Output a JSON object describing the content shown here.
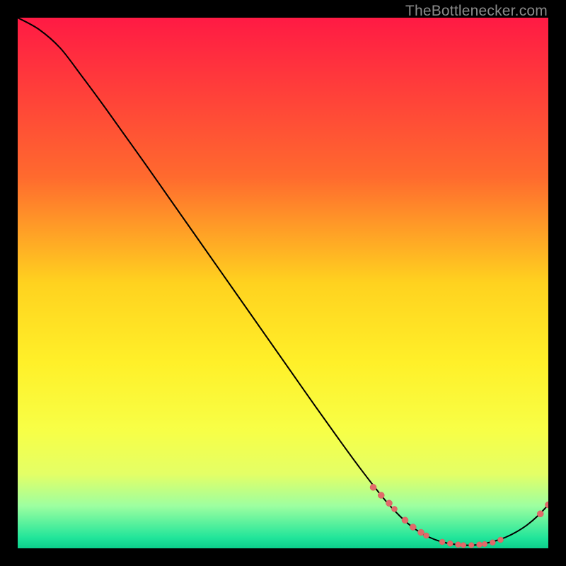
{
  "watermark": "TheBottlenecker.com",
  "colors": {
    "curve_stroke": "#000000",
    "marker_fill": "#e16a6a",
    "marker_stroke": "#d95b5b"
  },
  "chart_data": {
    "type": "line",
    "title": "",
    "xlabel": "",
    "ylabel": "",
    "xlim": [
      0,
      100
    ],
    "ylim": [
      0,
      100
    ],
    "grid": false,
    "legend": false,
    "gradient_stops": [
      {
        "pos": 0.0,
        "color": "#ff1a44"
      },
      {
        "pos": 0.3,
        "color": "#ff6a2e"
      },
      {
        "pos": 0.5,
        "color": "#ffd21f"
      },
      {
        "pos": 0.65,
        "color": "#fff029"
      },
      {
        "pos": 0.78,
        "color": "#f7ff47"
      },
      {
        "pos": 0.86,
        "color": "#e4ff66"
      },
      {
        "pos": 0.92,
        "color": "#9dffa0"
      },
      {
        "pos": 0.98,
        "color": "#21e59a"
      },
      {
        "pos": 1.0,
        "color": "#0ccf8c"
      }
    ],
    "series": [
      {
        "name": "bottleneck-curve",
        "x": [
          0,
          4,
          8,
          12,
          16,
          20,
          24,
          28,
          32,
          36,
          40,
          44,
          48,
          52,
          56,
          60,
          64,
          68,
          70,
          72,
          74,
          76,
          78,
          80,
          82,
          84,
          86,
          88,
          90,
          92,
          94,
          96,
          98,
          100
        ],
        "y": [
          100,
          97.8,
          94.3,
          89.1,
          83.7,
          78.1,
          72.5,
          66.8,
          61.1,
          55.4,
          49.7,
          44.0,
          38.3,
          32.6,
          26.9,
          21.3,
          15.8,
          10.6,
          8.2,
          6.1,
          4.3,
          2.9,
          1.9,
          1.2,
          0.8,
          0.6,
          0.6,
          0.9,
          1.4,
          2.1,
          3.1,
          4.4,
          6.1,
          8.2
        ]
      }
    ],
    "markers": [
      {
        "x": 67.0,
        "y": 11.5,
        "r": 4.5
      },
      {
        "x": 68.5,
        "y": 10.0,
        "r": 4.5
      },
      {
        "x": 70.0,
        "y": 8.5,
        "r": 4.5
      },
      {
        "x": 71.0,
        "y": 7.4,
        "r": 4.0
      },
      {
        "x": 73.0,
        "y": 5.3,
        "r": 4.5
      },
      {
        "x": 74.5,
        "y": 4.0,
        "r": 4.5
      },
      {
        "x": 76.0,
        "y": 3.0,
        "r": 4.5
      },
      {
        "x": 77.0,
        "y": 2.4,
        "r": 4.0
      },
      {
        "x": 80.0,
        "y": 1.2,
        "r": 4.0
      },
      {
        "x": 81.5,
        "y": 0.9,
        "r": 4.0
      },
      {
        "x": 83.0,
        "y": 0.7,
        "r": 4.0
      },
      {
        "x": 84.0,
        "y": 0.6,
        "r": 3.8
      },
      {
        "x": 85.5,
        "y": 0.6,
        "r": 3.8
      },
      {
        "x": 87.0,
        "y": 0.7,
        "r": 4.0
      },
      {
        "x": 88.0,
        "y": 0.8,
        "r": 3.8
      },
      {
        "x": 89.5,
        "y": 1.1,
        "r": 4.0
      },
      {
        "x": 91.0,
        "y": 1.6,
        "r": 4.0
      },
      {
        "x": 98.5,
        "y": 6.5,
        "r": 4.5
      },
      {
        "x": 100.0,
        "y": 8.2,
        "r": 4.5
      }
    ]
  }
}
